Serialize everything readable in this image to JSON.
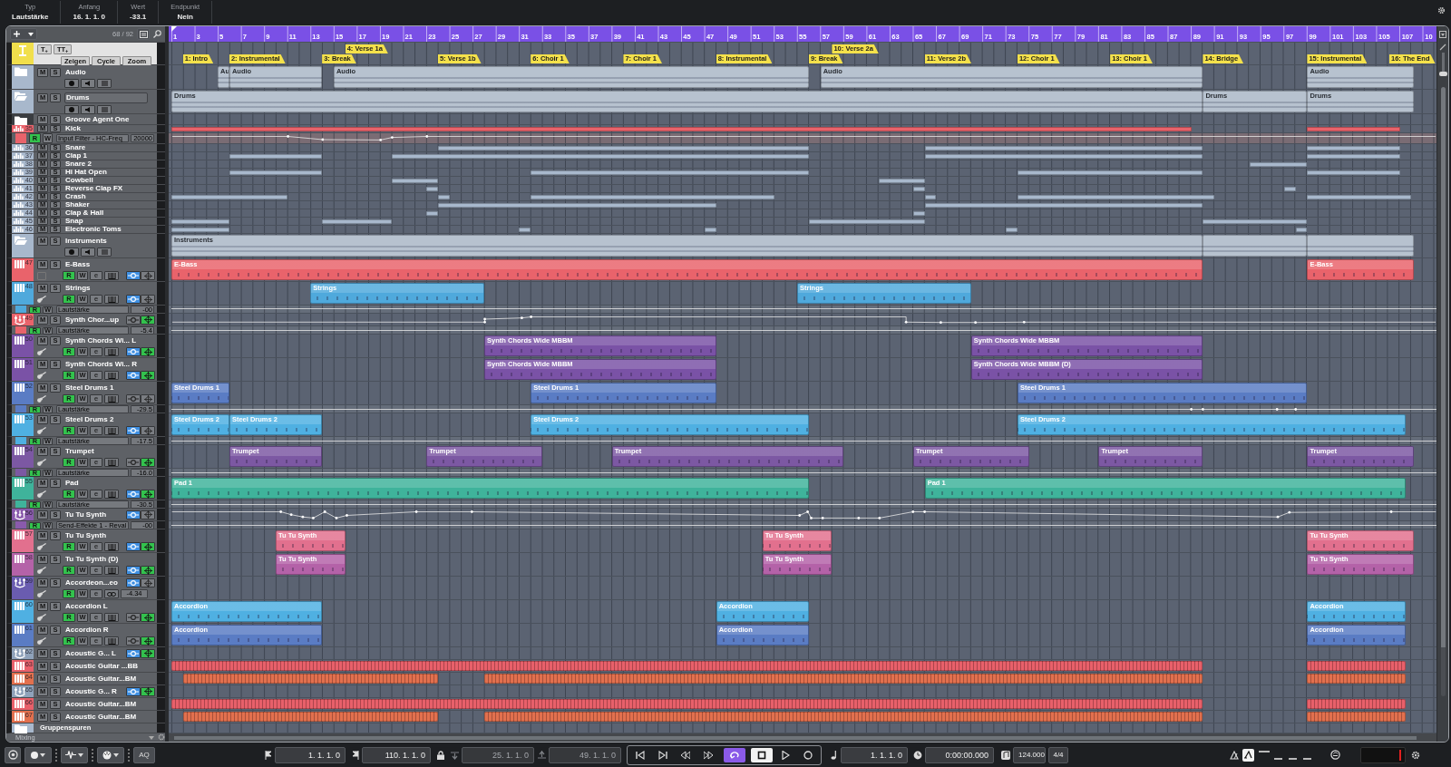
{
  "info_line": [
    {
      "label": "Typ",
      "value": "Lautstärke"
    },
    {
      "label": "Anfang",
      "value": "16. 1. 1. 0"
    },
    {
      "label": "Wert",
      "value": "-33.1"
    },
    {
      "label": "Endpunkt",
      "value": "Nein"
    }
  ],
  "track_list": {
    "count": "68 / 92"
  },
  "ruler": {
    "labels": [
      "1",
      "3",
      "5",
      "7",
      "9",
      "11",
      "13",
      "15",
      "17",
      "19",
      "21",
      "23",
      "25",
      "27",
      "29",
      "31",
      "33",
      "35",
      "37",
      "39",
      "41",
      "43",
      "45",
      "47",
      "49",
      "51",
      "53",
      "55",
      "57",
      "59",
      "61",
      "63",
      "65",
      "67",
      "69",
      "71",
      "73",
      "75",
      "77",
      "79",
      "81",
      "83",
      "85",
      "87",
      "89",
      "91",
      "93",
      "95",
      "97",
      "99",
      "101",
      "103",
      "105",
      "107",
      "10"
    ]
  },
  "marker_track": {
    "buttons": [
      "T$_{+}$",
      "TT$_{+}$"
    ],
    "view_buttons": [
      "Zeigen",
      "Cycle",
      "Zoom"
    ],
    "markers": [
      {
        "label": "1: Intro"
      },
      {
        "label": "2: Instrumental"
      },
      {
        "label": "3: Break"
      },
      {
        "label": "4: Verse 1a"
      },
      {
        "label": "5: Verse 1b"
      },
      {
        "label": "6: Choir 1"
      },
      {
        "label": "7: Choir 1"
      },
      {
        "label": "8: Instrumental"
      },
      {
        "label": "9: Break"
      },
      {
        "label": "10: Verse 2a"
      },
      {
        "label": "11: Verse 2b"
      },
      {
        "label": "12: Choir 1"
      },
      {
        "label": "13: Choir 1"
      },
      {
        "label": "14: Bridge"
      },
      {
        "label": "15: Instrumental"
      },
      {
        "label": "16: The End"
      }
    ]
  },
  "tracks": [
    {
      "kind": "folder",
      "name": "Audio",
      "mute": "M",
      "solo": "S",
      "expanded": false,
      "selected": false,
      "color": "#a8b8cc",
      "controls": true,
      "parts": [
        {
          "name": "Au"
        },
        {
          "name": "Audio"
        },
        {
          "name": "Audio"
        },
        {
          "name": "Audio"
        },
        {
          "name": "Audio"
        }
      ]
    },
    {
      "kind": "folder",
      "name": "Drums",
      "mute": "M",
      "solo": "S",
      "expanded": true,
      "selected": true,
      "color": "#a8b8cc",
      "controls": true,
      "parts": [
        {
          "name": "Drums"
        },
        {
          "name": "Drums"
        },
        {
          "name": "Drums"
        }
      ]
    },
    {
      "kind": "folder",
      "name": "Groove Agent One",
      "mute": "M",
      "solo": "S",
      "expanded": false,
      "selected": false,
      "color": "#3a3d41",
      "controls": false
    },
    {
      "kind": "drum",
      "number": "35",
      "name": "Kick",
      "mute": "M",
      "solo": "S",
      "color": "#e9636b"
    },
    {
      "kind": "automation",
      "read": {
        "label": "R",
        "on": true
      },
      "write": {
        "label": "W",
        "on": false
      },
      "label": "Input Filter - HC-Freq",
      "value": "20000",
      "curve": true
    },
    {
      "kind": "drum",
      "number": "36",
      "name": "Snare",
      "mute": "M",
      "solo": "S",
      "color": "#a8b8cc"
    },
    {
      "kind": "drum",
      "number": "37",
      "name": "Clap 1",
      "mute": "M",
      "solo": "S",
      "color": "#a8b8cc"
    },
    {
      "kind": "drum",
      "number": "38",
      "name": "Snare 2",
      "mute": "M",
      "solo": "S",
      "color": "#a8b8cc"
    },
    {
      "kind": "drum",
      "number": "39",
      "name": "Hi Hat Open",
      "mute": "M",
      "solo": "S",
      "color": "#a8b8cc"
    },
    {
      "kind": "drum",
      "number": "40",
      "name": "Cowbell",
      "mute": "M",
      "solo": "S",
      "color": "#a8b8cc"
    },
    {
      "kind": "drum",
      "number": "41",
      "name": "Reverse Clap FX",
      "mute": "M",
      "solo": "S",
      "color": "#a8b8cc"
    },
    {
      "kind": "drum",
      "number": "42",
      "name": "Crash",
      "mute": "M",
      "solo": "S",
      "color": "#a8b8cc"
    },
    {
      "kind": "drum",
      "number": "43",
      "name": "Shaker",
      "mute": "M",
      "solo": "S",
      "color": "#a8b8cc"
    },
    {
      "kind": "drum",
      "number": "44",
      "name": "Clap & Hall",
      "mute": "M",
      "solo": "S",
      "color": "#a8b8cc"
    },
    {
      "kind": "drum",
      "number": "45",
      "name": "Snap",
      "mute": "M",
      "solo": "S",
      "color": "#a8b8cc"
    },
    {
      "kind": "drum",
      "number": "46",
      "name": "Electronic Toms",
      "mute": "M",
      "solo": "S",
      "color": "#a8b8cc"
    },
    {
      "kind": "folder",
      "name": "Instruments",
      "mute": "M",
      "solo": "S",
      "expanded": true,
      "selected": false,
      "color": "#a8b8cc",
      "controls": true,
      "parts": [
        {
          "name": "Instruments"
        }
      ]
    },
    {
      "kind": "instrument",
      "number": "47",
      "name": "E-Bass",
      "mute": "M",
      "solo": "S",
      "color": "#e9636b",
      "picture": false,
      "controls": {
        "read": {
          "label": "R",
          "on": true
        },
        "write": {
          "label": "W",
          "on": false
        },
        "edit": "e",
        "toggles": [
          {
            "kind": "line_dot",
            "on": true
          },
          {
            "kind": "diamond",
            "on": false
          }
        ]
      },
      "parts": [
        {
          "name": "E-Bass"
        },
        {
          "name": "E-Bass"
        }
      ]
    },
    {
      "kind": "instrument",
      "number": "48",
      "name": "Strings",
      "mute": "M",
      "solo": "S",
      "color": "#4fa9dc",
      "picture": true,
      "controls": {
        "read": {
          "label": "R",
          "on": true
        },
        "write": {
          "label": "W",
          "on": false
        },
        "edit": "e",
        "toggles": [
          {
            "kind": "line_dot",
            "on": true
          },
          {
            "kind": "diamond",
            "on": false
          }
        ]
      },
      "parts": [
        {
          "name": "Strings"
        },
        {
          "name": "Strings"
        }
      ]
    },
    {
      "kind": "lane",
      "read": {
        "label": "R",
        "on": true
      },
      "write": {
        "label": "W",
        "on": false
      },
      "label": "Lautstärke",
      "value": "-00",
      "curve": true
    },
    {
      "kind": "rack",
      "number": "49",
      "name": "Synth Chor...up",
      "mute": "M",
      "solo": "S",
      "color": "#e9636b",
      "toggles": [
        {
          "kind": "line_dot",
          "on": false
        },
        {
          "kind": "diamond",
          "on": true
        }
      ],
      "curve": true
    },
    {
      "kind": "lane",
      "read": {
        "label": "R",
        "on": true
      },
      "write": {
        "label": "W",
        "on": false
      },
      "label": "Lautstärke",
      "value": "-5.4",
      "curve": true
    },
    {
      "kind": "instrument",
      "number": "50",
      "name": "Synth Chords Wi... L",
      "mute": "M",
      "solo": "S",
      "color": "#7a52a6",
      "picture": true,
      "controls": {
        "read": {
          "label": "R",
          "on": true
        },
        "write": {
          "label": "W",
          "on": false
        },
        "edit": "e",
        "toggles": [
          {
            "kind": "line_dot",
            "on": true
          },
          {
            "kind": "diamond",
            "on": true
          }
        ]
      },
      "parts": [
        {
          "name": "Synth Chords Wide MBBM"
        },
        {
          "name": "Synth Chords Wide MBBM"
        }
      ]
    },
    {
      "kind": "instrument",
      "number": "51",
      "name": "Synth Chords Wi... R",
      "mute": "M",
      "solo": "S",
      "color": "#7a52a6",
      "picture": true,
      "controls": {
        "read": {
          "label": "R",
          "on": true
        },
        "write": {
          "label": "W",
          "on": false
        },
        "edit": "e",
        "toggles": [
          {
            "kind": "line_dot",
            "on": true
          },
          {
            "kind": "diamond",
            "on": true
          }
        ]
      },
      "parts": [
        {
          "name": "Synth Chords Wide MBBM"
        },
        {
          "name": "Synth Chords Wide MBBM (D)"
        }
      ]
    },
    {
      "kind": "instrument",
      "number": "52",
      "name": "Steel Drums 1",
      "mute": "M",
      "solo": "S",
      "color": "#5a7cc4",
      "picture": true,
      "controls": {
        "read": {
          "label": "R",
          "on": true
        },
        "write": {
          "label": "W",
          "on": false
        },
        "edit": "e",
        "toggles": [
          {
            "kind": "line_dot",
            "on": false
          },
          {
            "kind": "diamond",
            "on": false
          }
        ]
      },
      "parts": [
        {
          "name": "Steel Drums 1"
        },
        {
          "name": "Steel Drums 1"
        },
        {
          "name": "Steel Drums 1"
        }
      ]
    },
    {
      "kind": "lane",
      "read": {
        "label": "R",
        "on": true
      },
      "write": {
        "label": "W",
        "on": false
      },
      "label": "Lautstärke",
      "value": "-29.5",
      "curve": true
    },
    {
      "kind": "instrument",
      "number": "53",
      "name": "Steel Drums 2",
      "mute": "M",
      "solo": "S",
      "color": "#4fb0e2",
      "picture": true,
      "controls": {
        "read": {
          "label": "R",
          "on": true
        },
        "write": {
          "label": "W",
          "on": false
        },
        "edit": "e",
        "toggles": [
          {
            "kind": "line_dot",
            "on": true
          },
          {
            "kind": "diamond",
            "on": false
          }
        ]
      },
      "parts": [
        {
          "name": "Steel Drums 2"
        },
        {
          "name": "Steel Drums 2"
        },
        {
          "name": "Steel Drums 2"
        },
        {
          "name": "Steel Drums 2"
        }
      ]
    },
    {
      "kind": "lane",
      "read": {
        "label": "R",
        "on": true
      },
      "write": {
        "label": "W",
        "on": false
      },
      "label": "Lautstärke",
      "value": "-17.5",
      "curve": true
    },
    {
      "kind": "instrument",
      "number": "54",
      "name": "Trumpet",
      "mute": "M",
      "solo": "S",
      "color": "#7c58a3",
      "picture": true,
      "controls": {
        "read": {
          "label": "R",
          "on": true
        },
        "write": {
          "label": "W",
          "on": false
        },
        "edit": "e",
        "toggles": [
          {
            "kind": "line_dot",
            "on": false
          },
          {
            "kind": "diamond",
            "on": true
          }
        ]
      },
      "parts": [
        {
          "name": "Trumpet"
        },
        {
          "name": "Trumpet"
        },
        {
          "name": "Trumpet"
        },
        {
          "name": "Trumpet"
        },
        {
          "name": "Trumpet"
        },
        {
          "name": "Trumpet"
        }
      ]
    },
    {
      "kind": "lane",
      "read": {
        "label": "R",
        "on": true
      },
      "write": {
        "label": "W",
        "on": false
      },
      "label": "Lautstärke",
      "value": "-16.0",
      "curve": true
    },
    {
      "kind": "instrument",
      "number": "55",
      "name": "Pad",
      "mute": "M",
      "solo": "S",
      "color": "#3fb39b",
      "picture": true,
      "controls": {
        "read": {
          "label": "R",
          "on": true
        },
        "write": {
          "label": "W",
          "on": false
        },
        "edit": "e",
        "toggles": [
          {
            "kind": "line_dot",
            "on": true
          },
          {
            "kind": "diamond",
            "on": true
          }
        ]
      },
      "parts": [
        {
          "name": "Pad 1"
        },
        {
          "name": "Pad 1"
        }
      ]
    },
    {
      "kind": "lane",
      "read": {
        "label": "R",
        "on": true
      },
      "write": {
        "label": "W",
        "on": false
      },
      "label": "Lautstärke",
      "value": "-30.5",
      "curve": true
    },
    {
      "kind": "rack",
      "number": "56",
      "name": "Tu Tu Synth",
      "mute": "M",
      "solo": "S",
      "color": "#8a5aac",
      "toggles": [
        {
          "kind": "line_dot",
          "on": true
        },
        {
          "kind": "diamond",
          "on": false
        }
      ],
      "curve": true
    },
    {
      "kind": "lane",
      "read": {
        "label": "R",
        "on": true
      },
      "write": {
        "label": "W",
        "on": false
      },
      "label": "Send-Effekte 1 - Reval",
      "value": "-00",
      "curve": true
    },
    {
      "kind": "instrument",
      "number": "57",
      "name": "Tu Tu Synth",
      "mute": "M",
      "solo": "S",
      "color": "#e2708e",
      "picture": true,
      "controls": {
        "read": {
          "label": "R",
          "on": true
        },
        "write": {
          "label": "W",
          "on": false
        },
        "edit": "e",
        "toggles": [
          {
            "kind": "line_dot",
            "on": true
          },
          {
            "kind": "diamond",
            "on": true
          }
        ]
      },
      "parts": [
        {
          "name": "Tu Tu Synth"
        },
        {
          "name": "Tu Tu Synth"
        },
        {
          "name": "Tu Tu Synth"
        }
      ]
    },
    {
      "kind": "instrument",
      "number": "58",
      "name": "Tu Tu Synth (D)",
      "mute": "M",
      "solo": "S",
      "color": "#b462a8",
      "picture": true,
      "controls": {
        "read": {
          "label": "R",
          "on": true
        },
        "write": {
          "label": "W",
          "on": false
        },
        "edit": "e",
        "toggles": [
          {
            "kind": "line_dot",
            "on": true
          },
          {
            "kind": "diamond",
            "on": true
          }
        ]
      },
      "parts": [
        {
          "name": "Tu Tu Synth"
        },
        {
          "name": "Tu Tu Synth"
        },
        {
          "name": "Tu Tu Synth"
        }
      ]
    },
    {
      "kind": "rack",
      "number": "59",
      "name": "Accordeon...eo",
      "mute": "M",
      "solo": "S",
      "color": "#6a5cb0",
      "toggles": [
        {
          "kind": "line_dot",
          "on": true
        },
        {
          "kind": "diamond",
          "on": false
        }
      ],
      "automation": {
        "read": {
          "label": "R",
          "on": true
        },
        "write": {
          "label": "W",
          "on": false
        },
        "edit": "e",
        "value": "-4.34"
      }
    },
    {
      "kind": "instrument",
      "number": "60",
      "name": "Accordion L",
      "mute": "M",
      "solo": "S",
      "color": "#4fb0e2",
      "picture": true,
      "controls": {
        "read": {
          "label": "R",
          "on": true
        },
        "write": {
          "label": "W",
          "on": false
        },
        "edit": "e",
        "toggles": [
          {
            "kind": "line_dot",
            "on": false
          },
          {
            "kind": "diamond",
            "on": true
          }
        ]
      },
      "parts": [
        {
          "name": "Accordion"
        },
        {
          "name": "Accordion"
        },
        {
          "name": "Accordion"
        }
      ]
    },
    {
      "kind": "instrument",
      "number": "61",
      "name": "Accordion R",
      "mute": "M",
      "solo": "S",
      "color": "#5a7cc4",
      "picture": true,
      "controls": {
        "read": {
          "label": "R",
          "on": true
        },
        "write": {
          "label": "W",
          "on": false
        },
        "edit": "e",
        "toggles": [
          {
            "kind": "line_dot",
            "on": false
          },
          {
            "kind": "diamond",
            "on": true
          }
        ]
      },
      "parts": [
        {
          "name": "Accordion"
        },
        {
          "name": "Accordion"
        },
        {
          "name": "Accordion"
        }
      ]
    },
    {
      "kind": "rack",
      "number": "62",
      "name": "Acoustic G... L",
      "mute": "M",
      "solo": "S",
      "color": "#8fa2ba",
      "toggles": [
        {
          "kind": "line_dot",
          "on": true
        },
        {
          "kind": "diamond",
          "on": true
        }
      ]
    },
    {
      "kind": "instrument",
      "number": "63",
      "name": "Acoustic Guitar ...BB",
      "mute": "M",
      "solo": "S",
      "color": "#e8606a"
    },
    {
      "kind": "instrument",
      "number": "64",
      "name": "Acoustic Guitar...BM",
      "mute": "M",
      "solo": "S",
      "color": "#e2704e"
    },
    {
      "kind": "rack",
      "number": "65",
      "name": "Acoustic G... R",
      "mute": "M",
      "solo": "S",
      "color": "#8fa2ba",
      "toggles": [
        {
          "kind": "line_dot",
          "on": true
        },
        {
          "kind": "diamond",
          "on": true
        }
      ]
    },
    {
      "kind": "instrument",
      "number": "66",
      "name": "Acoustic Guitar...BM",
      "mute": "M",
      "solo": "S",
      "color": "#e8606a"
    },
    {
      "kind": "instrument",
      "number": "67",
      "name": "Acoustic Guitar...BM",
      "mute": "M",
      "solo": "S",
      "color": "#e2704e"
    }
  ],
  "group_tracks": {
    "name": "Gruppenspuren"
  },
  "footer": {
    "label": "Mixing"
  },
  "vertical_zoom": {
    "level": 0.1
  },
  "transport": {
    "aq": "AQ",
    "left_locator": "1. 1. 1. 0",
    "right_locator": "110. 1. 1. 0",
    "punch_in": {
      "value": "25. 1. 1. 0",
      "disabled": true
    },
    "punch_out": {
      "value": "49. 1. 1. 0",
      "disabled": true
    },
    "buttons": [
      {
        "kind": "to_start",
        "on": false
      },
      {
        "kind": "to_end",
        "on": false
      },
      {
        "kind": "rewind",
        "on": false
      },
      {
        "kind": "forward",
        "on": false
      },
      {
        "kind": "cycle",
        "on": true
      },
      {
        "kind": "stop",
        "on": true
      },
      {
        "kind": "play",
        "on": false
      },
      {
        "kind": "record",
        "on": false
      }
    ],
    "position": "1. 1. 1. 0",
    "time": "0:00:00.000",
    "tempo": "124.000",
    "signature": "4/4"
  }
}
